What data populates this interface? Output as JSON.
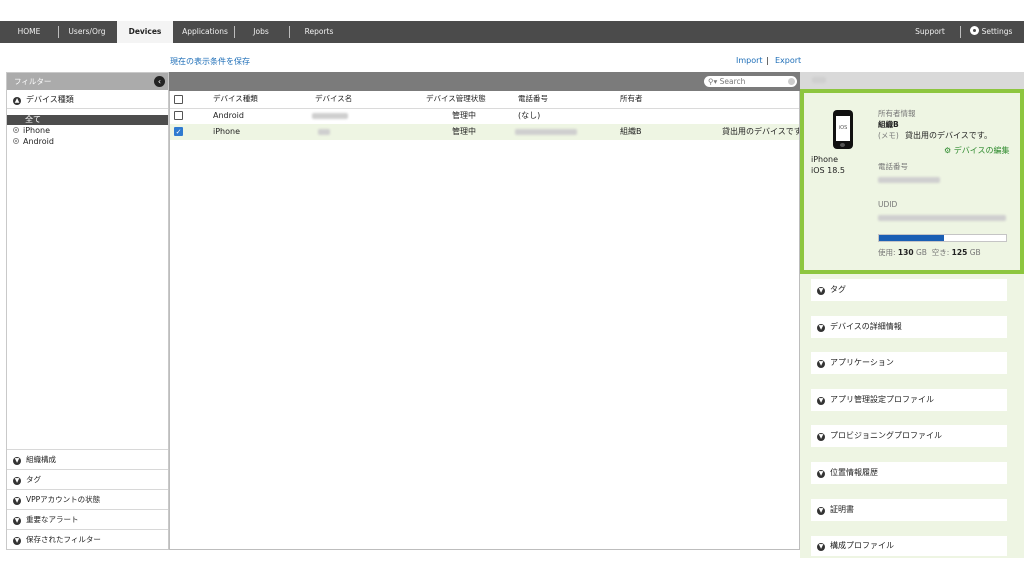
{
  "nav": {
    "tabs": [
      "HOME",
      "Users/Org",
      "Devices",
      "Applications",
      "Jobs",
      "Reports"
    ],
    "active": "Devices",
    "support": "Support",
    "settings": "Settings"
  },
  "toolbar": {
    "save_condition": "現在の表示条件を保存",
    "import": "Import",
    "sep": "|",
    "export": "Export"
  },
  "sidebar": {
    "title": "フィルター",
    "device_type": "デバイス種類",
    "all": "全て",
    "options": [
      "iPhone",
      "Android"
    ],
    "bottom_sections": [
      "組織構成",
      "タグ",
      "VPPアカウントの状態",
      "重要なアラート",
      "保存されたフィルター"
    ]
  },
  "search": {
    "placeholder": "Search"
  },
  "table": {
    "columns": [
      "デバイス種類",
      "デバイス名",
      "デバイス管理状態",
      "電話番号",
      "所有者"
    ],
    "rows": [
      {
        "type": "Android",
        "status": "管理中",
        "phone": "(なし)",
        "owner": "",
        "memo": "",
        "checked": false
      },
      {
        "type": "iPhone",
        "status": "管理中",
        "phone": "",
        "owner": "組織B",
        "memo": "貸出用のデバイスです",
        "checked": true
      }
    ]
  },
  "detail": {
    "model": "iPhone",
    "os": "iOS 18.5",
    "screen_icon": "iOS",
    "owner_label": "所有者情報",
    "owner": "組織B",
    "memo_label": "(メモ)",
    "memo": "貸出用のデバイスです。",
    "edit_link": "デバイスの編集",
    "phone_label": "電話番号",
    "udid_label": "UDID",
    "storage": {
      "used_label": "使用:",
      "used": "130",
      "free_label": "空き:",
      "free": "125",
      "unit": "GB",
      "used_fraction": 0.51
    }
  },
  "accordions": [
    "タグ",
    "デバイスの詳細情報",
    "アプリケーション",
    "アプリ管理設定プロファイル",
    "プロビジョニングプロファイル",
    "位置情報履歴",
    "証明書",
    "構成プロファイル"
  ]
}
